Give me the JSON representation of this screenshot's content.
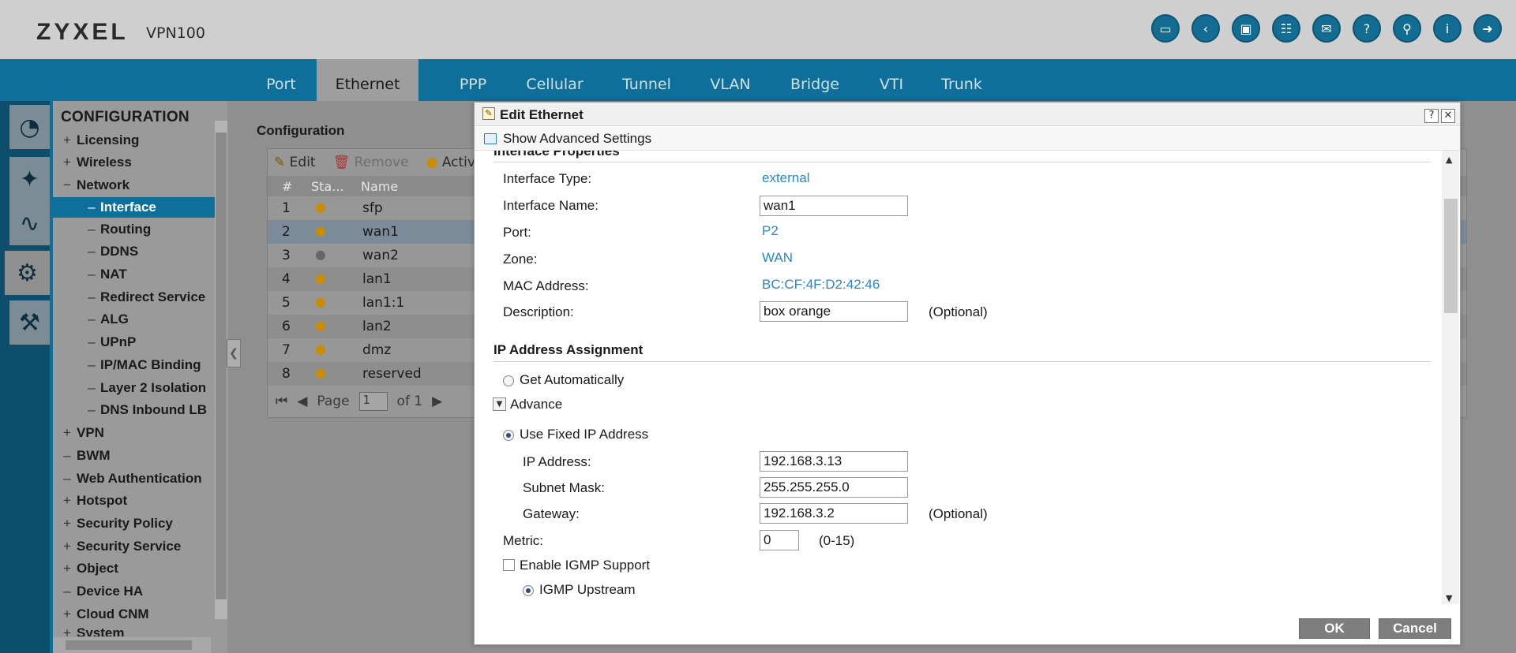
{
  "header": {
    "brand": "ZYXEL",
    "model": "VPN100",
    "icons": [
      "console-icon",
      "cli-icon",
      "window-icon",
      "sitemap-icon",
      "chat-icon",
      "help-icon",
      "pin-icon",
      "info-icon",
      "logout-icon"
    ]
  },
  "nav": {
    "tabs": [
      "Port",
      "Ethernet",
      "PPP",
      "Cellular",
      "Tunnel",
      "VLAN",
      "Bridge",
      "VTI",
      "Trunk"
    ],
    "active": "Ethernet"
  },
  "rail": [
    "dashboard-icon",
    "wizard-icon",
    "monitor-icon",
    "gear-icon",
    "tools-icon"
  ],
  "sidebar": {
    "title": "CONFIGURATION",
    "items": [
      {
        "sign": "+",
        "label": "Licensing"
      },
      {
        "sign": "+",
        "label": "Wireless"
      },
      {
        "sign": "−",
        "label": "Network"
      },
      {
        "sign": "–",
        "label": "Interface"
      },
      {
        "sign": "–",
        "label": "Routing"
      },
      {
        "sign": "–",
        "label": "DDNS"
      },
      {
        "sign": "–",
        "label": "NAT"
      },
      {
        "sign": "–",
        "label": "Redirect Service"
      },
      {
        "sign": "–",
        "label": "ALG"
      },
      {
        "sign": "–",
        "label": "UPnP"
      },
      {
        "sign": "–",
        "label": "IP/MAC Binding"
      },
      {
        "sign": "–",
        "label": "Layer 2 Isolation"
      },
      {
        "sign": "–",
        "label": "DNS Inbound LB"
      },
      {
        "sign": "+",
        "label": "VPN"
      },
      {
        "sign": "–",
        "label": "BWM"
      },
      {
        "sign": "–",
        "label": "Web Authentication"
      },
      {
        "sign": "+",
        "label": "Hotspot"
      },
      {
        "sign": "+",
        "label": "Security Policy"
      },
      {
        "sign": "+",
        "label": "Security Service"
      },
      {
        "sign": "+",
        "label": "Object"
      },
      {
        "sign": "–",
        "label": "Device HA"
      },
      {
        "sign": "+",
        "label": "Cloud CNM"
      },
      {
        "sign": "+",
        "label": "System"
      }
    ]
  },
  "content": {
    "title": "Configuration",
    "toolbar": {
      "edit": "Edit",
      "remove": "Remove",
      "activate": "Activ"
    },
    "columns": {
      "num": "#",
      "status": "Sta...",
      "name": "Name"
    },
    "rows": [
      {
        "num": "1",
        "name": "sfp",
        "on": true
      },
      {
        "num": "2",
        "name": "wan1",
        "on": true
      },
      {
        "num": "3",
        "name": "wan2",
        "on": false
      },
      {
        "num": "4",
        "name": "lan1",
        "on": true
      },
      {
        "num": "5",
        "name": "lan1:1",
        "on": true
      },
      {
        "num": "6",
        "name": "lan2",
        "on": true
      },
      {
        "num": "7",
        "name": "dmz",
        "on": true
      },
      {
        "num": "8",
        "name": "reserved",
        "on": true
      }
    ],
    "pager": {
      "page_label": "Page",
      "page": "1",
      "of": "of 1"
    }
  },
  "dialog": {
    "title": "Edit Ethernet",
    "show_advanced": "Show Advanced Settings",
    "section_props": "Interface Properties",
    "interface_type_label": "Interface Type:",
    "interface_type": "external",
    "interface_name_label": "Interface Name:",
    "interface_name": "wan1",
    "port_label": "Port:",
    "port": "P2",
    "zone_label": "Zone:",
    "zone": "WAN",
    "mac_label": "MAC Address:",
    "mac": "BC:CF:4F:D2:42:46",
    "description_label": "Description:",
    "description": "box orange",
    "optional": "(Optional)",
    "section_ip": "IP Address Assignment",
    "get_auto": "Get Automatically",
    "advance": "Advance",
    "use_fixed": "Use Fixed IP Address",
    "ip_label": "IP Address:",
    "ip": "192.168.3.13",
    "mask_label": "Subnet Mask:",
    "mask": "255.255.255.0",
    "gateway_label": "Gateway:",
    "gateway": "192.168.3.2",
    "metric_label": "Metric:",
    "metric": "0",
    "metric_range": "(0-15)",
    "igmp_label": "Enable IGMP Support",
    "igmp_upstream": "IGMP Upstream",
    "ok": "OK",
    "cancel": "Cancel"
  }
}
